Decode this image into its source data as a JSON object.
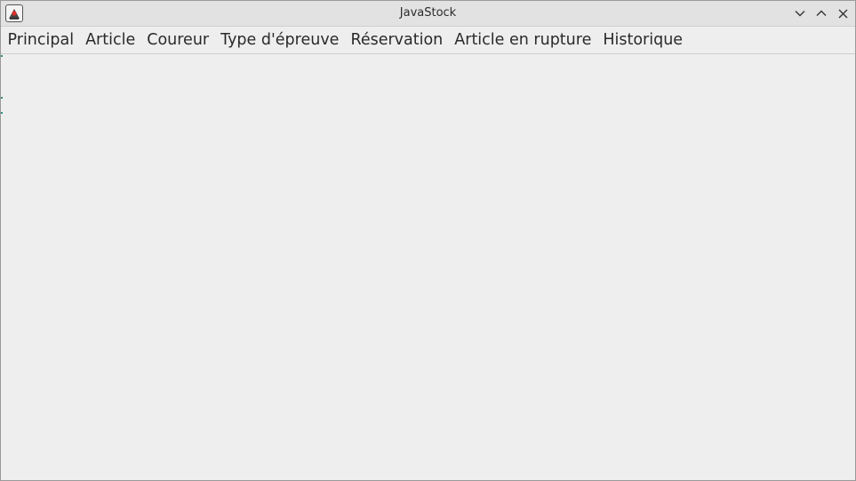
{
  "window": {
    "title": "JavaStock",
    "icon": "java-app-icon",
    "controls": [
      {
        "name": "minimize",
        "icon": "chevron-down-icon"
      },
      {
        "name": "maximize",
        "icon": "chevron-up-icon"
      },
      {
        "name": "close",
        "icon": "close-icon"
      }
    ]
  },
  "menubar": {
    "items": [
      {
        "label": "Principal"
      },
      {
        "label": "Article"
      },
      {
        "label": "Coureur"
      },
      {
        "label": "Type d'épreuve"
      },
      {
        "label": "Réservation"
      },
      {
        "label": "Article en rupture"
      },
      {
        "label": "Historique"
      }
    ]
  },
  "colors": {
    "titlebar_bg": "#e2e2e2",
    "window_bg": "#eeeeee",
    "text": "#2a2a2a"
  }
}
